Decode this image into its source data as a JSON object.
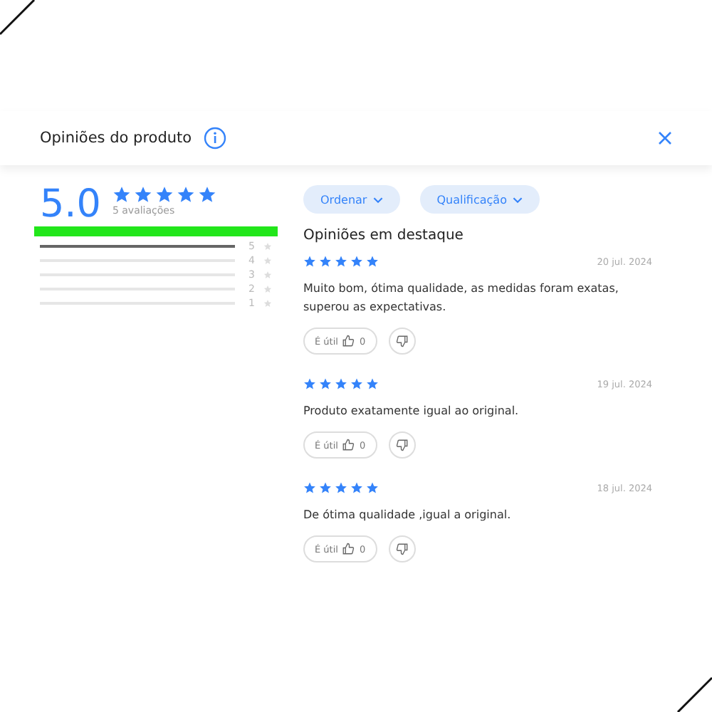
{
  "header": {
    "title": "Opiniões do produto"
  },
  "summary": {
    "score": "5.0",
    "stars": 5,
    "count": "5 avaliações",
    "highlighted": true
  },
  "distribution": [
    {
      "label": "5",
      "level": 1
    },
    {
      "label": "4",
      "level": 0
    },
    {
      "label": "3",
      "level": 0
    },
    {
      "label": "2",
      "level": 0
    },
    {
      "label": "1",
      "level": 0
    }
  ],
  "filters": [
    "Ordenar",
    "Qualificação"
  ],
  "section_title": "Opiniões em destaque",
  "reviews": [
    {
      "stars": 5,
      "date": "20 jul. 2024",
      "text": "Muito bom, ótima qualidade, as medidas foram exatas, superou as expectativas.",
      "useful_label": "É útil",
      "useful_count": "0"
    },
    {
      "stars": 5,
      "date": "19 jul. 2024",
      "text": "Produto exatamente igual ao original.",
      "useful_label": "É útil",
      "useful_count": "0"
    },
    {
      "stars": 5,
      "date": "18 jul. 2024",
      "text": "De ótima qualidade ,igual a original.",
      "useful_label": "É útil",
      "useful_count": "0"
    }
  ]
}
